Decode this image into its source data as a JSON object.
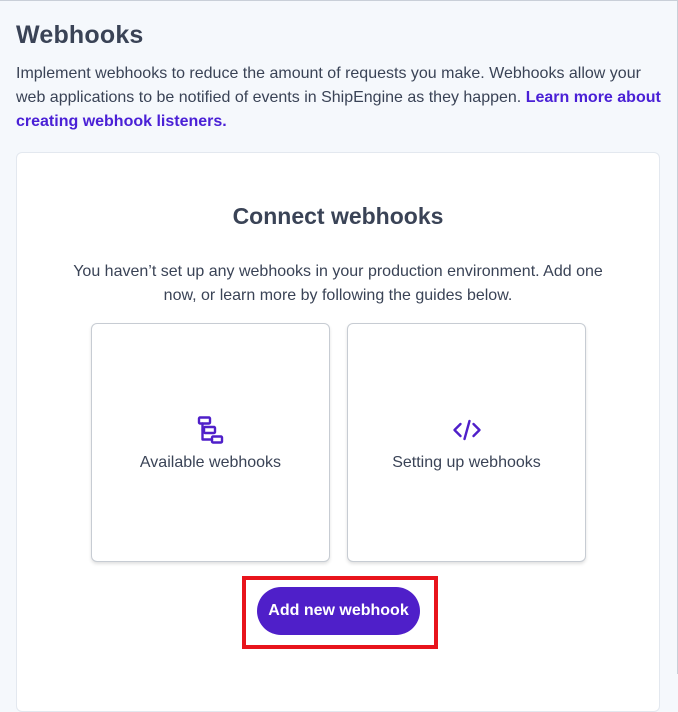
{
  "header": {
    "title": "Webhooks",
    "intro_text": "Implement webhooks to reduce the amount of requests you make. Webhooks allow your web applications to be notified of events in ShipEngine as they happen. ",
    "intro_link": "Learn more about creating webhook listeners."
  },
  "connect_card": {
    "title": "Connect webhooks",
    "description": "You haven’t set up any webhooks in your production environment. Add one now, or learn more by following the guides below.",
    "tiles": [
      {
        "label": "Available webhooks",
        "icon": "flow-diagram-icon"
      },
      {
        "label": "Setting up webhooks",
        "icon": "code-icon"
      }
    ],
    "add_button_label": "Add new webhook"
  },
  "colors": {
    "accent": "#4f1fc9",
    "link": "#4a20d6",
    "highlight_border": "#e8141c",
    "text": "#3a4356",
    "background": "#f5f8fc"
  }
}
